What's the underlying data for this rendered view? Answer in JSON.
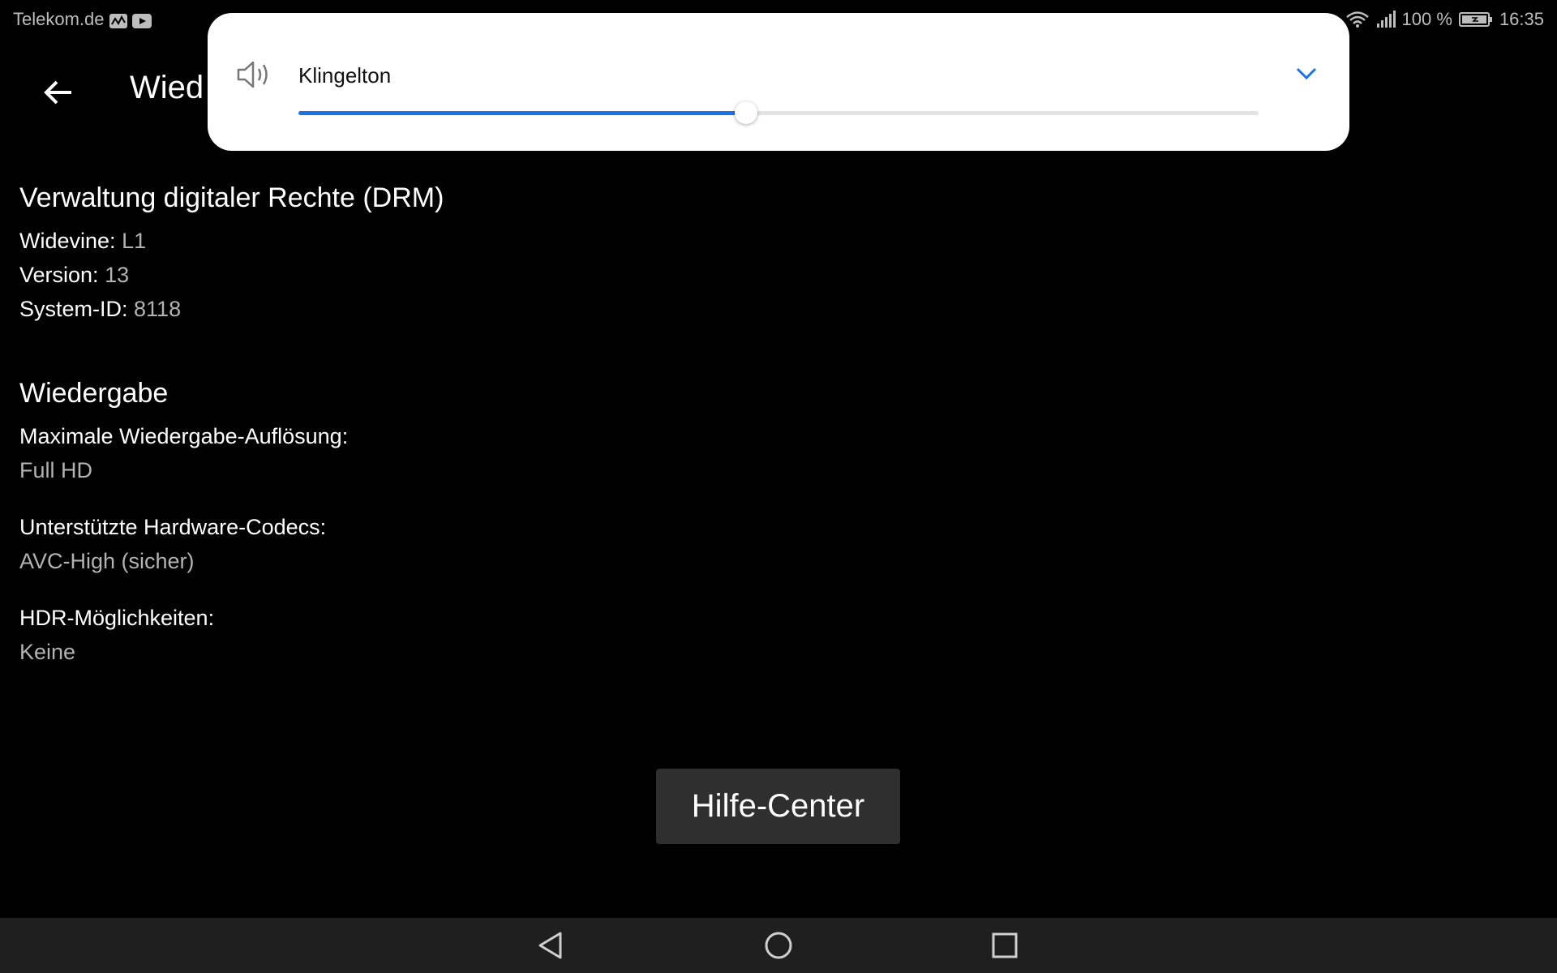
{
  "status_bar": {
    "carrier": "Telekom.de",
    "battery": "100 %",
    "time": "16:35",
    "icons": [
      "activity-icon",
      "youtube-icon",
      "wifi-icon",
      "signal-icon",
      "battery-icon"
    ]
  },
  "app_bar": {
    "title": "Wied",
    "back_icon": "arrow-left-icon"
  },
  "volume_panel": {
    "label": "Klingelton",
    "level": 0.466,
    "accent_color": "#1a73e8",
    "icons": [
      "speaker-icon",
      "chevron-down-icon"
    ]
  },
  "drm_section": {
    "heading": "Verwaltung digitaler Rechte (DRM)",
    "rows": [
      {
        "label": "Widevine:",
        "value": "L1"
      },
      {
        "label": "Version:",
        "value": "13"
      },
      {
        "label": "System-ID:",
        "value": "8118"
      }
    ]
  },
  "playback_section": {
    "heading": "Wiedergabe",
    "items": [
      {
        "label": "Maximale Wiedergabe-Auflösung:",
        "value": "Full HD"
      },
      {
        "label": "Unterstützte Hardware-Codecs:",
        "value": "AVC-High (sicher)"
      },
      {
        "label": "HDR-Möglichkeiten:",
        "value": "Keine"
      }
    ]
  },
  "help_button": {
    "label": "Hilfe-Center"
  },
  "nav_bar": {
    "buttons": [
      "back-triangle-icon",
      "home-circle-icon",
      "recents-square-icon"
    ]
  }
}
